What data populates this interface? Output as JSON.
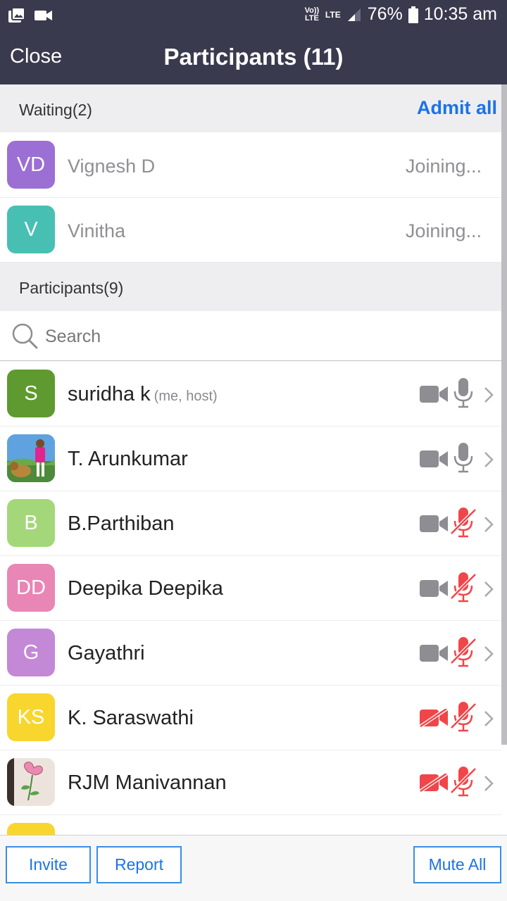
{
  "status_bar": {
    "volte": "Vo)) LTE",
    "lte": "LTE",
    "battery": "76%",
    "time": "10:35 am"
  },
  "header": {
    "close_label": "Close",
    "title": "Participants (11)"
  },
  "waiting": {
    "label": "Waiting(2)",
    "admit_all": "Admit all",
    "items": [
      {
        "initials": "VD",
        "name": "Vignesh D",
        "status": "Joining...",
        "color": "#9b6fd3"
      },
      {
        "initials": "V",
        "name": "Vinitha",
        "status": "Joining...",
        "color": "#48bfb3"
      }
    ]
  },
  "participants": {
    "label": "Participants(9)",
    "search_placeholder": "Search",
    "items": [
      {
        "initials": "S",
        "name": "suridha k",
        "tag": "(me, host)",
        "color": "#5e9a2f",
        "video": "on",
        "audio": "on"
      },
      {
        "initials": "",
        "name": "T. Arunkumar",
        "tag": "",
        "color": "#6aa0d8",
        "photo": "photo-person",
        "video": "on",
        "audio": "on"
      },
      {
        "initials": "B",
        "name": "B.Parthiban",
        "tag": "",
        "color": "#a4d77a",
        "video": "on",
        "audio": "off"
      },
      {
        "initials": "DD",
        "name": "Deepika Deepika",
        "tag": "",
        "color": "#e886b5",
        "video": "on",
        "audio": "off"
      },
      {
        "initials": "G",
        "name": "Gayathri",
        "tag": "",
        "color": "#c388d6",
        "video": "on",
        "audio": "off"
      },
      {
        "initials": "KS",
        "name": "K. Saraswathi",
        "tag": "",
        "color": "#f8d62e",
        "video": "off",
        "audio": "off"
      },
      {
        "initials": "",
        "name": "RJM Manivannan",
        "tag": "",
        "color": "#e9e1d9",
        "photo": "photo-flower",
        "video": "off",
        "audio": "off"
      }
    ]
  },
  "footer": {
    "invite": "Invite",
    "report": "Report",
    "mute_all": "Mute All"
  },
  "colors": {
    "header_bg": "#393a4e",
    "accent_blue": "#1a73e8",
    "icon_gray": "#8d8d92",
    "muted_red": "#f0464a"
  }
}
